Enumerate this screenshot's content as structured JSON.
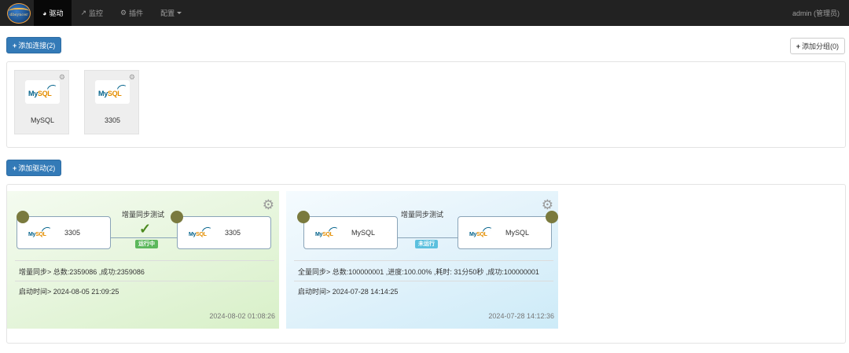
{
  "navbar": {
    "logo_text": "dbsyncer",
    "items": [
      {
        "label": "驱动",
        "icon": "dashboard-icon",
        "active": true
      },
      {
        "label": "监控",
        "icon": "line-chart-icon",
        "active": false
      },
      {
        "label": "插件",
        "icon": "plugin-icon",
        "active": false
      },
      {
        "label": "配置",
        "icon": "",
        "active": false,
        "dropdown": true
      }
    ],
    "user": "admin (管理员)"
  },
  "connections": {
    "add_button": "添加连接(2)",
    "add_group_button": "添加分组(0)",
    "cards": [
      {
        "name": "MySQL",
        "type": "MySQL"
      },
      {
        "name": "3305",
        "type": "MySQL"
      }
    ]
  },
  "drivers": {
    "add_button": "添加驱动(2)",
    "cards": [
      {
        "title": "增量同步测试",
        "source": "3305",
        "target": "3305",
        "state": "运行中",
        "info_line": "增量同步> 总数:2359086 ,成功:2359086",
        "start_line": "启动时间> 2024-08-05 21:09:25",
        "timestamp": "2024-08-02 01:08:26",
        "color": "#dff2d1"
      },
      {
        "title": "增量同步测试",
        "source": "MySQL",
        "target": "MySQL",
        "state": "未运行",
        "info_line": "全量同步> 总数:100000001 ,进度:100.00% ,耗时: 31分50秒 ,成功:100000001",
        "start_line": "启动时间> 2024-07-28 14:14:25",
        "timestamp": "2024-07-28 14:12:36",
        "color": "#d6eef9"
      }
    ]
  },
  "mysql_logo": {
    "my": "My",
    "sql": "SQL"
  }
}
